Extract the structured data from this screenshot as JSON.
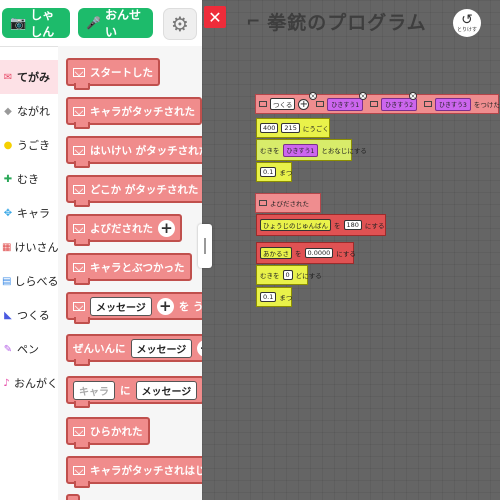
{
  "toolbar": {
    "photo_label": "しゃしん",
    "sound_label": "おんせい"
  },
  "categories": [
    {
      "label": "てがみ",
      "icon": "envelope-icon",
      "color": "#e84c6a"
    },
    {
      "label": "ながれ",
      "icon": "flow-icon",
      "color": "#999999"
    },
    {
      "label": "うごき",
      "icon": "move-icon",
      "color": "#f5d000"
    },
    {
      "label": "むき",
      "icon": "direction-icon",
      "color": "#2aa858"
    },
    {
      "label": "キャラ",
      "icon": "character-icon",
      "color": "#3aa8e6"
    },
    {
      "label": "けいさん",
      "icon": "calculator-icon",
      "color": "#e05050"
    },
    {
      "label": "しらべる",
      "icon": "search-icon",
      "color": "#3a8ae6"
    },
    {
      "label": "つくる",
      "icon": "create-icon",
      "color": "#4a5ae0"
    },
    {
      "label": "ペン",
      "icon": "pen-icon",
      "color": "#b45fe6"
    },
    {
      "label": "おんがく",
      "icon": "music-icon",
      "color": "#e64aa8"
    }
  ],
  "palette": {
    "b1": "スタートした",
    "b2": "キャラがタッチされた",
    "b3": "はいけい がタッチされた",
    "b4": "どこか がタッチされた",
    "b5": "よびだされた",
    "b6": "キャラとぶつかった",
    "b7_box": "メッセージ",
    "b7_tail": "を う",
    "b8_pre": "ぜんいんに",
    "b8_box": "メッセージ",
    "b9_box1": "キャラ",
    "b9_mid": "に",
    "b9_box2": "メッセージ",
    "b10": "ひらかれた",
    "b11": "キャラがタッチされはじ"
  },
  "stage": {
    "title": "拳銃のプログラム",
    "undo_label": "とりけす",
    "prog1": {
      "head_label": "つくる",
      "chars": [
        "ひきすう1",
        "ひきすう2",
        "ひきすう3"
      ],
      "head_tail": "をつけたし",
      "move_x": "400",
      "move_y": "215",
      "move_label": "にうごく",
      "dir_label": "むきを",
      "dir_char": "ひきすう1",
      "dir_tail": "とおなじにする",
      "wait_val": "0.1",
      "wait_label": "まつ"
    },
    "prog2": {
      "head_label": "よびだされた",
      "var1": "ひょうじのじゅんばん",
      "var1_mid": "を",
      "var1_val": "180",
      "var1_tail": "にする",
      "var2": "あかるさ",
      "var2_mid": "を",
      "var2_val": "0.0000",
      "var2_tail": "にする",
      "dir_label": "むきを",
      "dir_val": "0",
      "dir_tail": "どにする",
      "wait_val": "0.1",
      "wait_label": "まつ"
    }
  }
}
